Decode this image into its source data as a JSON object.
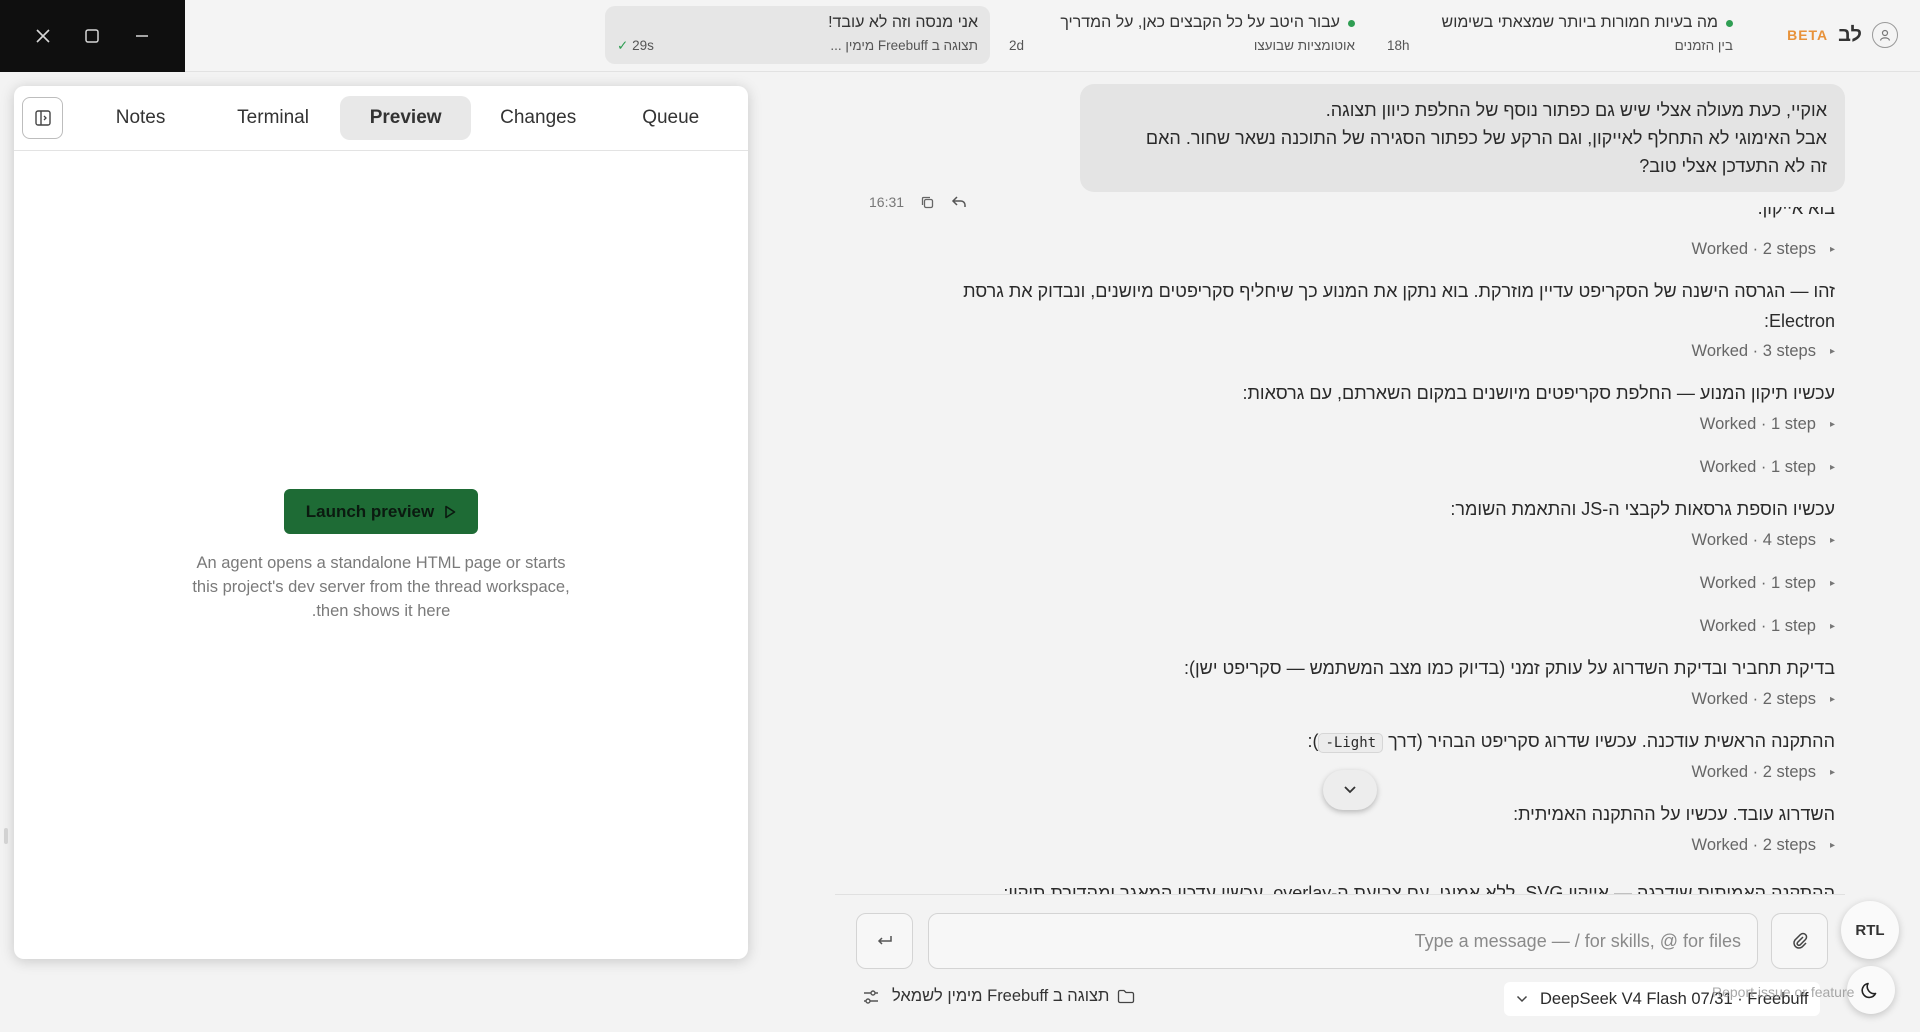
{
  "window": {
    "controls": {
      "close": "close-icon",
      "maximize": "maximize-icon",
      "minimize": "minimize-icon"
    }
  },
  "tabs": [
    {
      "title": "אני מנסה וזה לא עובד!",
      "subtitle": "תצוגה ב Freebuff מימין ...",
      "time": "29s",
      "status": "done"
    },
    {
      "title": "עבור היטב על כל הקבצים כאן, על המדריך",
      "subtitle": "אוטומציות שבועצו",
      "time": "2d",
      "status": "running"
    },
    {
      "title": "מה בעיות חמורות ביותר שמצאתי בשימוש",
      "subtitle": "בין הזמנים",
      "time": "18h",
      "status": "running"
    }
  ],
  "brand": {
    "badge": "BETA",
    "name": "לב"
  },
  "panel": {
    "tabs": [
      "Notes",
      "Terminal",
      "Preview",
      "Changes",
      "Queue"
    ],
    "active_tab": "Preview",
    "launch_label": "Launch preview",
    "description_lines": [
      "An agent opens a standalone HTML page or starts",
      "this project's dev server from the thread workspace,",
      ".then shows it here"
    ]
  },
  "chat": {
    "user_message_lines": [
      "אוקיי, כעת מעולה אצלי שיש גם כפתור נוסף של החלפת כיוון תצוגה.",
      "אבל האימוגי לא התחלף לאייקון, וגם הרקע של כפתור הסגירה של התוכנה נשאר שחור. האם",
      "זה לא התעדכן אצלי טוב?"
    ],
    "user_message_time": "16:31",
    "cut_top_text": "בוא אייקון.",
    "messages": [
      {
        "type": "worked",
        "label": "Worked · 2 steps"
      },
      {
        "type": "text",
        "lines": [
          "זהו — הגרסה הישנה של הסקריפט עדיין מוזרקת. בוא נתקן את המנוע כך שיחליף סקריפטים מיושנים, ונבדוק את גרסת",
          "Electron:"
        ]
      },
      {
        "type": "worked",
        "label": "Worked · 3 steps"
      },
      {
        "type": "text",
        "lines": [
          "עכשיו תיקון המנוע — החלפת סקריפטים מיושנים במקום השארתם, עם גרסאות:"
        ]
      },
      {
        "type": "worked",
        "label": "Worked · 1 step"
      },
      {
        "type": "worked",
        "label": "Worked · 1 step"
      },
      {
        "type": "text",
        "lines": [
          "עכשיו הוספת גרסאות לקבצי ה-JS והתאמת השומר:"
        ]
      },
      {
        "type": "worked",
        "label": "Worked · 4 steps"
      },
      {
        "type": "worked",
        "label": "Worked · 1 step"
      },
      {
        "type": "worked",
        "label": "Worked · 1 step"
      },
      {
        "type": "text",
        "lines": [
          "בדיקת תחביר ובדיקת השדרוג על עותק זמני (בדיוק כמו מצב המשתמש — סקריפט ישן):"
        ]
      },
      {
        "type": "worked",
        "label": "Worked · 2 steps"
      },
      {
        "type": "text_code",
        "before": "ההתקנה הראשית עודכנה. עכשיו שדרוג סקריפט הבהיר (דרך ",
        "code": "-Light",
        "after": "):"
      },
      {
        "type": "worked",
        "label": "Worked · 2 steps"
      },
      {
        "type": "text",
        "lines": [
          "השדרוג עובד. עכשיו על ההתקנה האמיתית:"
        ]
      },
      {
        "type": "worked",
        "label": "Worked · 2 steps"
      }
    ],
    "cut_bottom_text": "ההתקנה האמיתית שודרגה — אייקון SVG, ללא אמוגי, עם צביעת ה-overlay. עכשיו עדכון המאגר ומהדורת תיקון:"
  },
  "composer": {
    "placeholder": "Type a message — / for skills, @ for files",
    "direction_button": "RTL"
  },
  "footer": {
    "folder_label": "תצוגה ב Freebuff מימין לשמאל",
    "model_label": "DeepSeek V4 Flash 07/31 · Freebuff",
    "report_label": "Report issue or feature"
  },
  "colors": {
    "accent_green": "#1e6b35",
    "status_green": "#2f9e53",
    "beta_orange": "#e8923a",
    "window_controls_bg": "#0f0f0f"
  }
}
